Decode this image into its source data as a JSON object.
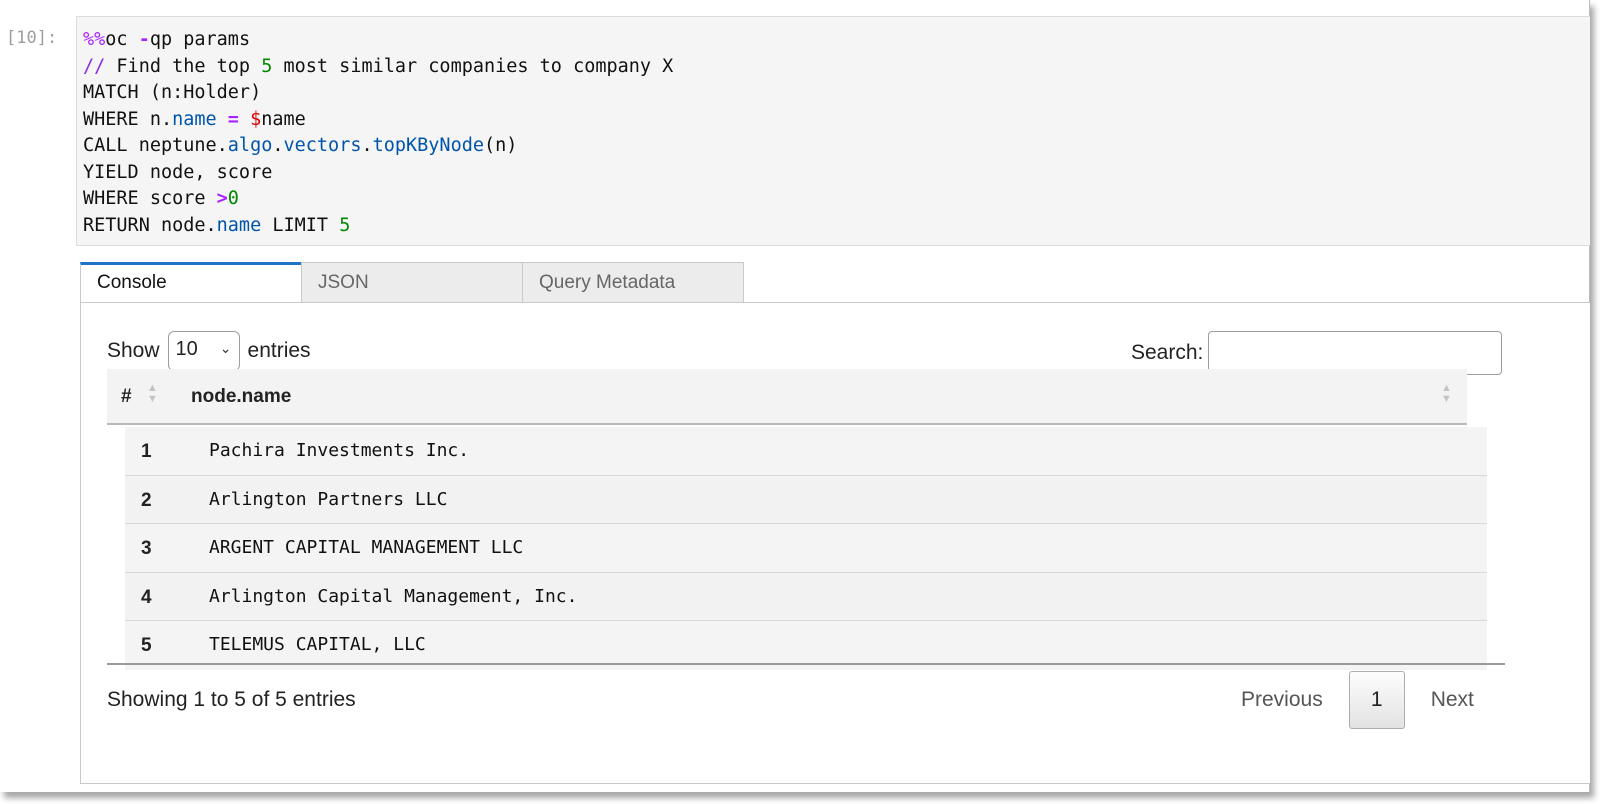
{
  "cell": {
    "prompt": "[10]:",
    "code": {
      "magic_prefix": "%%",
      "magic_name": "oc",
      "magic_flag": "-",
      "magic_args": "qp params",
      "comment_marker": "//",
      "comment_a": " Find the top ",
      "comment_num": "5",
      "comment_b": " most similar companies to company X",
      "match_line": "MATCH (n:Holder)",
      "where_kw": "WHERE n.",
      "where_prop": "name",
      "where_eq": " = ",
      "where_dollar": "$",
      "where_param": "name",
      "call_kw": "CALL neptune.",
      "call_algo": "algo",
      "call_dot1": ".",
      "call_vectors": "vectors",
      "call_dot2": ".",
      "call_fn": "topKByNode",
      "call_args": "(n)",
      "yield_line": "YIELD node, score",
      "where2_kw": "WHERE score ",
      "where2_op": ">",
      "where2_num": "0",
      "return_kw": "RETURN node.",
      "return_prop": "name",
      "return_limit": " LIMIT ",
      "return_num": "5"
    }
  },
  "output": {
    "tabs": [
      {
        "label": "Console",
        "active": true
      },
      {
        "label": "JSON",
        "active": false
      },
      {
        "label": "Query Metadata",
        "active": false
      }
    ],
    "length": {
      "show": "Show",
      "value": "10",
      "entries": "entries"
    },
    "search": {
      "label": "Search:",
      "value": ""
    },
    "table": {
      "columns": [
        "#",
        "node.name"
      ],
      "rows": [
        {
          "num": "1",
          "name": "Pachira Investments Inc."
        },
        {
          "num": "2",
          "name": "Arlington Partners LLC"
        },
        {
          "num": "3",
          "name": "ARGENT CAPITAL MANAGEMENT LLC"
        },
        {
          "num": "4",
          "name": "Arlington Capital Management, Inc."
        },
        {
          "num": "5",
          "name": "TELEMUS CAPITAL, LLC"
        }
      ]
    },
    "info": "Showing 1 to 5 of 5 entries",
    "pagination": {
      "previous": "Previous",
      "current": "1",
      "next": "Next"
    }
  },
  "colors": {
    "active_tab_accent": "#1e74c8",
    "keyword_magenta": "#aa22ff",
    "number_green": "#008800",
    "property_blue": "#0055aa",
    "param_red": "#dd0000"
  }
}
